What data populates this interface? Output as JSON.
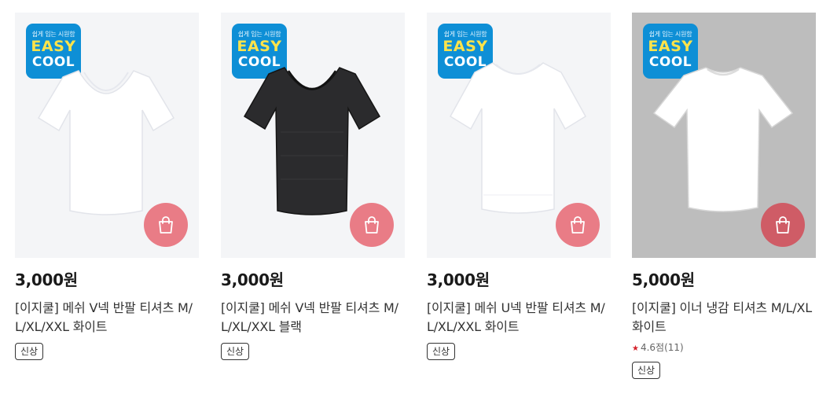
{
  "products": [
    {
      "badge_sub": "쉽게 입는 시원함",
      "badge_easy": "EASY",
      "badge_cool": "COOL",
      "shirt_icon": "white-v-neck-tshirt",
      "cart_icon": "shopping-bag-icon",
      "price": "3,000원",
      "title": "[이지쿨] 메쉬 V넥 반팔 티셔츠 M/L/XL/XXL 화이트",
      "tag": "신상"
    },
    {
      "badge_sub": "쉽게 입는 시원함",
      "badge_easy": "EASY",
      "badge_cool": "COOL",
      "shirt_icon": "black-v-neck-tshirt",
      "cart_icon": "shopping-bag-icon",
      "price": "3,000원",
      "title": "[이지쿨] 메쉬 V넥 반팔 티셔츠 M/L/XL/XXL 블랙",
      "tag": "신상"
    },
    {
      "badge_sub": "쉽게 입는 시원함",
      "badge_easy": "EASY",
      "badge_cool": "COOL",
      "shirt_icon": "white-u-neck-tshirt",
      "cart_icon": "shopping-bag-icon",
      "price": "3,000원",
      "title": "[이지쿨] 메쉬 U넥 반팔 티셔츠 M/L/XL/XXL 화이트",
      "tag": "신상"
    },
    {
      "badge_sub": "쉽게 입는 시원함",
      "badge_easy": "EASY",
      "badge_cool": "COOL",
      "shirt_icon": "white-crew-neck-tshirt",
      "cart_icon": "shopping-bag-icon",
      "price": "5,000원",
      "title": "[이지쿨] 이너 냉감 티셔츠 M/L/XL 화이트",
      "rating": "4.6점(11)",
      "tag": "신상"
    }
  ],
  "colors": {
    "badge_bg": "#0e8fd6",
    "badge_easy": "#ffe34a",
    "cart_button": "#e97c86",
    "rating_star": "#d4202a"
  }
}
